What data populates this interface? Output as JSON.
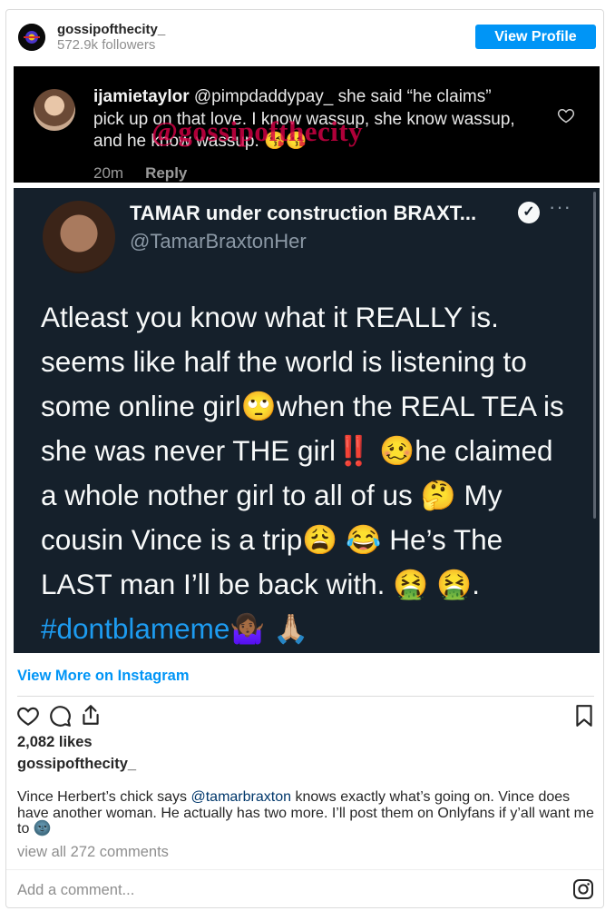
{
  "header": {
    "username": "gossipofthecity_",
    "followers": "572.9k followers",
    "view_profile": "View Profile"
  },
  "screenshot": {
    "comment": {
      "username": "ijamietaylor",
      "mention": "@pimpdaddypay_",
      "text": " she said “he claims” pick up on that love. I know wassup, she know wassup, and he know wassup. 😘😘",
      "watermark": "@gossipofthecity",
      "time": "20m",
      "reply": "Reply"
    },
    "tweet": {
      "name": "TAMAR under construction BRAXT...",
      "verified": "✓",
      "more": "···",
      "handle": "@TamarBraxtonHer",
      "body": "Atleast you know what it REALLY is. seems like half the world is listening to some online girl🙄when the REAL TEA is she was never THE girl‼️ 🥴he claimed a whole nother girl to all of us 🤔 My cousin Vince is a trip😩 😂 He’s The LAST man I’ll be back with. 🤮 🤮.",
      "hashtag": "#dontblameme🤷🏾‍♀️ 🙏🏼"
    }
  },
  "view_more": "View More on Instagram",
  "actions": {
    "like_icon": "heart-icon",
    "comment_icon": "comment-icon",
    "share_icon": "share-icon",
    "save_icon": "bookmark-icon"
  },
  "likes": "2,082 likes",
  "caption": {
    "owner": "gossipofthecity_",
    "text_before": "Vince Herbert’s chick says ",
    "mention": "@tamarbraxton",
    "text_after": " knows exactly what’s going on. Vince does have another woman. He actually has two more. I’ll post them on Onlyfans if y’all want me to 🌚"
  },
  "view_all_comments": "view all 272 comments",
  "add_comment_placeholder": "Add a comment..."
}
